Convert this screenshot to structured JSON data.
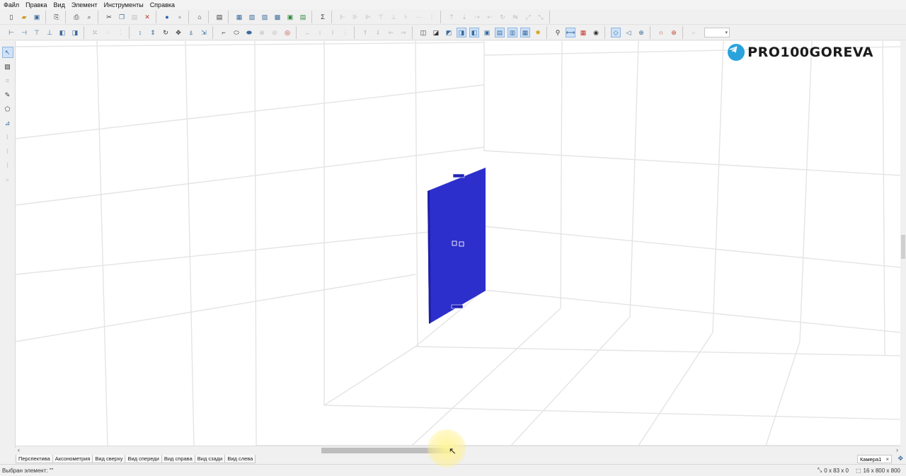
{
  "menu": [
    {
      "label": "Файл"
    },
    {
      "label": "Правка"
    },
    {
      "label": "Вид"
    },
    {
      "label": "Элемент"
    },
    {
      "label": "Инструменты"
    },
    {
      "label": "Справка"
    }
  ],
  "icons": {
    "new": "new-document-icon",
    "open": "open-folder-icon",
    "save": "save-icon",
    "print": "print-icon",
    "cut": "cut-icon",
    "copy": "copy-icon",
    "paste": "paste-icon",
    "delete": "delete-icon",
    "render": "render-sphere-icon",
    "sum": "sigma-icon",
    "select": "select-arrow-icon",
    "lamp": "light-bulb-icon",
    "eye": "eye-icon",
    "telegram": "telegram-icon"
  },
  "watermark": {
    "text": "PRO100GOREVA",
    "color": "#2aa3dc"
  },
  "scene": {
    "panel_color": "#2d2fcc",
    "grid_color": "#e4e4e4"
  },
  "view_tabs": [
    {
      "label": "Перспектива",
      "active": false
    },
    {
      "label": "Аксонометрия",
      "active": false
    },
    {
      "label": "Вид сверху",
      "active": false
    },
    {
      "label": "Вид спереди",
      "active": false
    },
    {
      "label": "Вид справа",
      "active": false
    },
    {
      "label": "Вид сзади",
      "active": false
    },
    {
      "label": "Вид слева",
      "active": false
    }
  ],
  "camera_tab": {
    "label": "Камера1",
    "close": "×"
  },
  "status": {
    "selected": "Выбран элемент: \"\"",
    "size": "0 x 83 x 0",
    "room": "16 x 800 x 800"
  }
}
